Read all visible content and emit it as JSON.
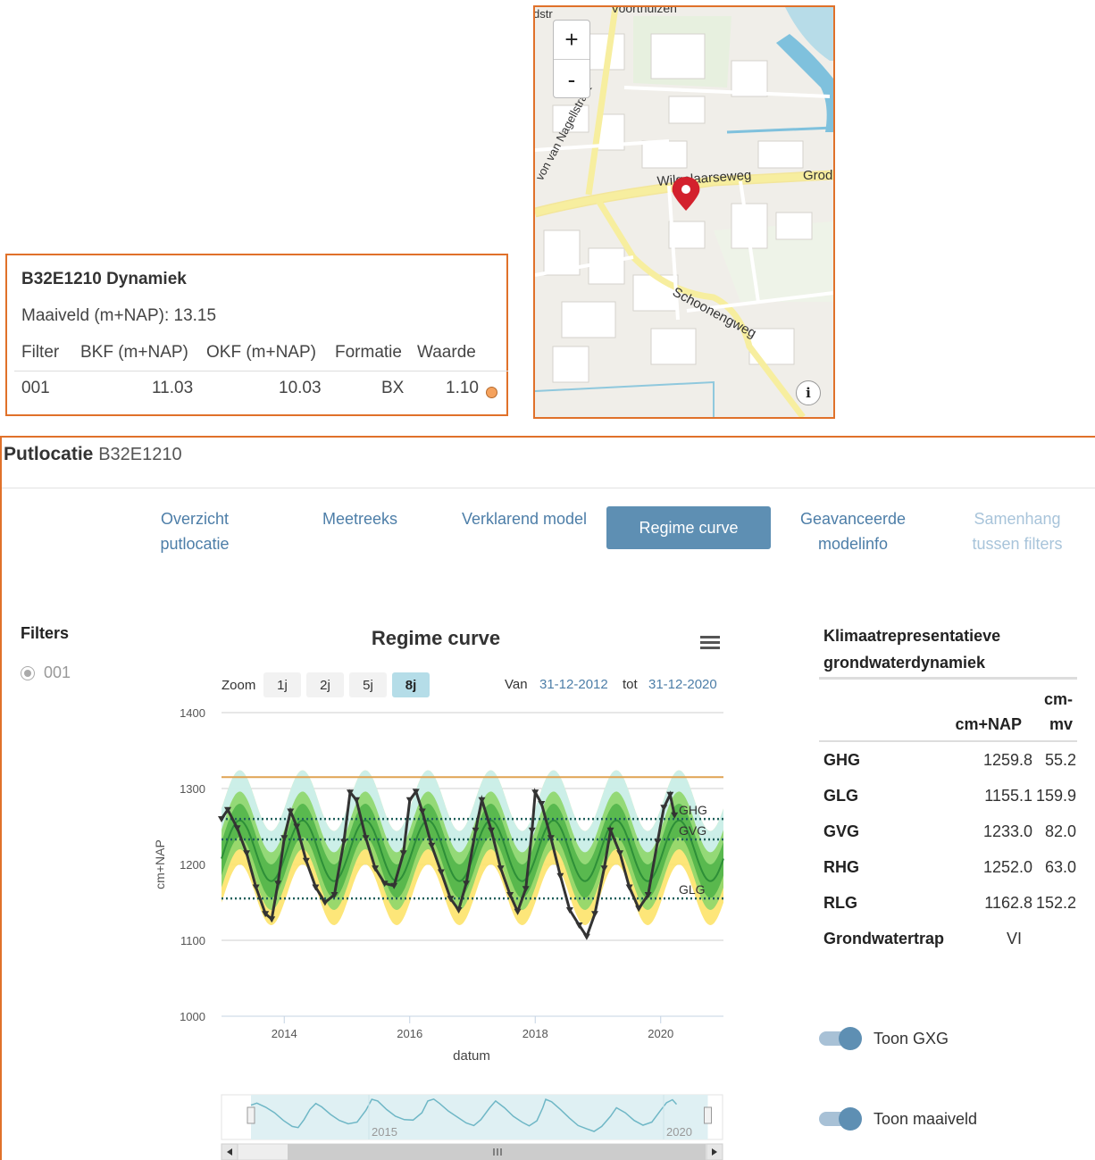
{
  "info": {
    "title": "B32E1210 Dynamiek",
    "maaiveld": "Maaiveld (m+NAP): 13.15",
    "headers": [
      "Filter",
      "BKF (m+NAP)",
      "OKF (m+NAP)",
      "Formatie",
      "Waarde"
    ],
    "row": [
      "001",
      "11.03",
      "10.03",
      "BX",
      "1.10"
    ],
    "status_color": "#f5a25d"
  },
  "map": {
    "zoom_in": "+",
    "zoom_out": "-",
    "info": "i",
    "labels": {
      "top": "Voorthuizen",
      "topleft": "dstr",
      "street1": "von van Nagellstraat",
      "street2": "Wilgelaarseweg",
      "street3": "Grod",
      "street4": "Schoonengweg"
    },
    "marker_color": "#d3212d"
  },
  "putlocatie": {
    "title": "Putlocatie",
    "id": "B32E1210"
  },
  "tabs": [
    {
      "l1": "Overzicht",
      "l2": "putlocatie",
      "state": "normal"
    },
    {
      "l1": "Meetreeks",
      "l2": "",
      "state": "normal"
    },
    {
      "l1": "Verklarend model",
      "l2": "",
      "state": "normal"
    },
    {
      "l1": "Regime curve",
      "l2": "",
      "state": "active"
    },
    {
      "l1": "Geavanceerde",
      "l2": "modelinfo",
      "state": "normal"
    },
    {
      "l1": "Samenhang",
      "l2": "tussen filters",
      "state": "disabled"
    }
  ],
  "filters": {
    "title": "Filters",
    "items": [
      "001"
    ]
  },
  "chart_ui": {
    "menu_icon": "hamburger-icon",
    "zoom_label": "Zoom",
    "zoom_options": [
      "1j",
      "2j",
      "5j",
      "8j"
    ],
    "zoom_selected": "8j",
    "van_label": "Van",
    "van_value": "31-12-2012",
    "tot_label": "tot",
    "tot_value": "31-12-2020",
    "navigator_labels": [
      "2015",
      "2020"
    ]
  },
  "chart_data": {
    "type": "line",
    "title": "Regime curve",
    "xlabel": "datum",
    "ylabel": "cm+NAP",
    "x_range": [
      2013.0,
      2021.0
    ],
    "ylim": [
      1000,
      1400
    ],
    "y_ticks": [
      1000,
      1100,
      1200,
      1300,
      1400
    ],
    "x_ticks": [
      2014,
      2016,
      2018,
      2020
    ],
    "maaiveld": 1315,
    "gxg_lines": [
      {
        "name": "GHG",
        "value": 1259.8
      },
      {
        "name": "GVG",
        "value": 1233.0
      },
      {
        "name": "GLG",
        "value": 1155.1
      }
    ],
    "bands": [
      {
        "name": "outer",
        "color": "#fde36a",
        "upper_amp": 66,
        "lower_amp": 58
      },
      {
        "name": "upper",
        "color": "#c6eff4",
        "upper_amp": 66,
        "lower_amp": 0
      },
      {
        "name": "mid",
        "color": "#8ed66a",
        "upper_amp": 38,
        "lower_amp": 38
      },
      {
        "name": "inner",
        "color": "#52b54a",
        "upper_amp": 22,
        "lower_amp": 22
      }
    ],
    "median": {
      "center": 1218,
      "amplitude": 40,
      "peak_month": 3.5,
      "color": "#2e8f38"
    },
    "observations": {
      "color": "#333333",
      "series": [
        {
          "x": 2013.0,
          "y": 1260
        },
        {
          "x": 2013.1,
          "y": 1272
        },
        {
          "x": 2013.25,
          "y": 1248
        },
        {
          "x": 2013.4,
          "y": 1215
        },
        {
          "x": 2013.55,
          "y": 1170
        },
        {
          "x": 2013.7,
          "y": 1135
        },
        {
          "x": 2013.8,
          "y": 1128
        },
        {
          "x": 2013.9,
          "y": 1175
        },
        {
          "x": 2014.0,
          "y": 1235
        },
        {
          "x": 2014.1,
          "y": 1270
        },
        {
          "x": 2014.2,
          "y": 1250
        },
        {
          "x": 2014.35,
          "y": 1205
        },
        {
          "x": 2014.5,
          "y": 1170
        },
        {
          "x": 2014.65,
          "y": 1150
        },
        {
          "x": 2014.8,
          "y": 1160
        },
        {
          "x": 2014.95,
          "y": 1230
        },
        {
          "x": 2015.05,
          "y": 1295
        },
        {
          "x": 2015.15,
          "y": 1285
        },
        {
          "x": 2015.3,
          "y": 1235
        },
        {
          "x": 2015.45,
          "y": 1195
        },
        {
          "x": 2015.6,
          "y": 1175
        },
        {
          "x": 2015.75,
          "y": 1172
        },
        {
          "x": 2015.9,
          "y": 1215
        },
        {
          "x": 2016.0,
          "y": 1285
        },
        {
          "x": 2016.1,
          "y": 1296
        },
        {
          "x": 2016.2,
          "y": 1270
        },
        {
          "x": 2016.35,
          "y": 1225
        },
        {
          "x": 2016.5,
          "y": 1190
        },
        {
          "x": 2016.65,
          "y": 1155
        },
        {
          "x": 2016.78,
          "y": 1140
        },
        {
          "x": 2016.9,
          "y": 1175
        },
        {
          "x": 2017.05,
          "y": 1245
        },
        {
          "x": 2017.15,
          "y": 1285
        },
        {
          "x": 2017.3,
          "y": 1245
        },
        {
          "x": 2017.45,
          "y": 1195
        },
        {
          "x": 2017.6,
          "y": 1160
        },
        {
          "x": 2017.72,
          "y": 1138
        },
        {
          "x": 2017.85,
          "y": 1168
        },
        {
          "x": 2017.95,
          "y": 1245
        },
        {
          "x": 2018.0,
          "y": 1295
        },
        {
          "x": 2018.1,
          "y": 1280
        },
        {
          "x": 2018.25,
          "y": 1235
        },
        {
          "x": 2018.4,
          "y": 1185
        },
        {
          "x": 2018.55,
          "y": 1140
        },
        {
          "x": 2018.7,
          "y": 1120
        },
        {
          "x": 2018.82,
          "y": 1105
        },
        {
          "x": 2018.95,
          "y": 1135
        },
        {
          "x": 2019.1,
          "y": 1195
        },
        {
          "x": 2019.2,
          "y": 1245
        },
        {
          "x": 2019.35,
          "y": 1215
        },
        {
          "x": 2019.5,
          "y": 1170
        },
        {
          "x": 2019.65,
          "y": 1142
        },
        {
          "x": 2019.8,
          "y": 1160
        },
        {
          "x": 2019.95,
          "y": 1230
        },
        {
          "x": 2020.05,
          "y": 1275
        },
        {
          "x": 2020.15,
          "y": 1292
        },
        {
          "x": 2020.22,
          "y": 1265
        }
      ]
    },
    "navigator_x": [
      2012.5,
      2021.0
    ]
  },
  "climate": {
    "title_l1": "Klimaatrepresentatieve",
    "title_l2": "grondwaterdynamiek",
    "col1": "cm+NAP",
    "col2_l1": "cm-",
    "col2_l2": "mv",
    "rows": [
      {
        "label": "GHG",
        "nap": "1259.8",
        "mv": "55.2"
      },
      {
        "label": "GLG",
        "nap": "1155.1",
        "mv": "159.9"
      },
      {
        "label": "GVG",
        "nap": "1233.0",
        "mv": "82.0"
      },
      {
        "label": "RHG",
        "nap": "1252.0",
        "mv": "63.0"
      },
      {
        "label": "RLG",
        "nap": "1162.8",
        "mv": "152.2"
      },
      {
        "label": "Grondwatertrap",
        "nap": "VI",
        "mv": ""
      }
    ]
  },
  "toggles": [
    {
      "label": "Toon GXG",
      "on": true
    },
    {
      "label": "Toon maaiveld",
      "on": true
    }
  ]
}
